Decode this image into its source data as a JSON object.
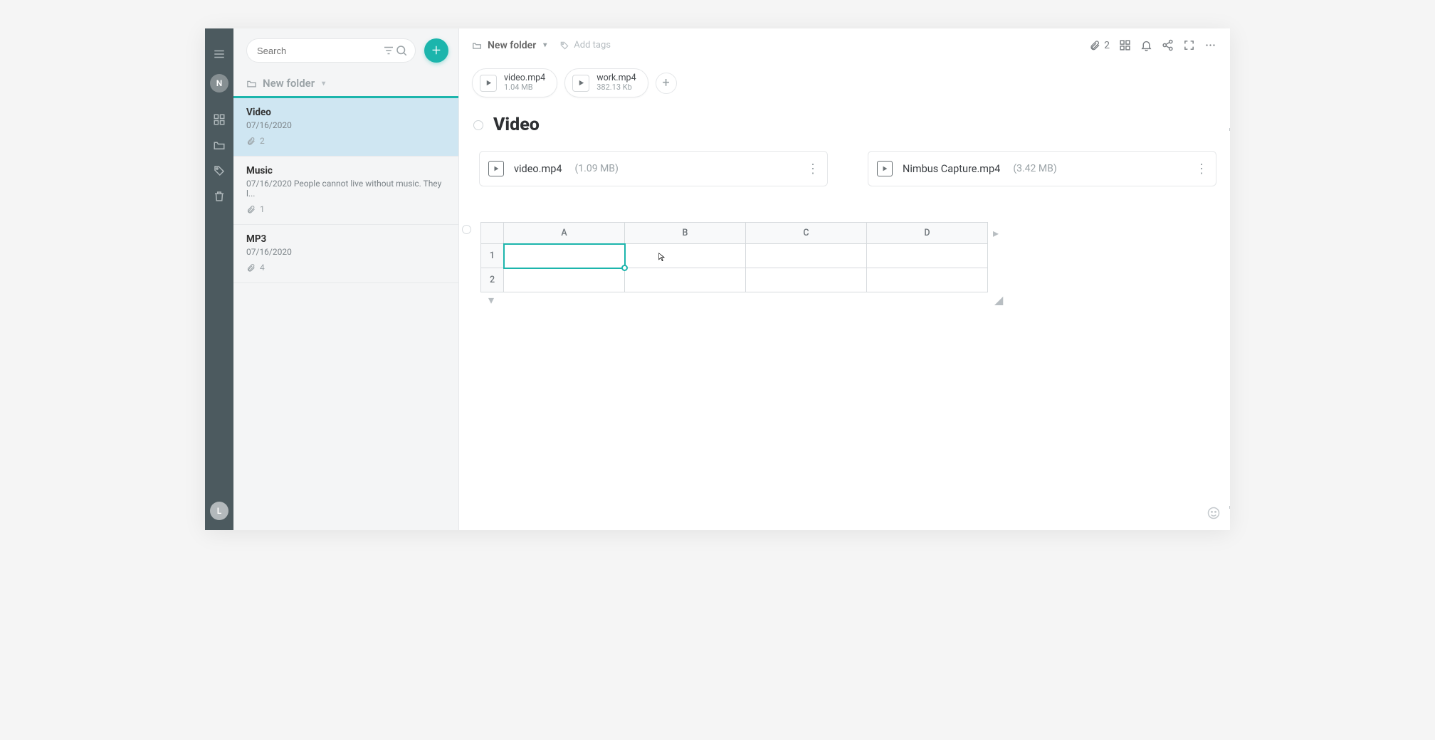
{
  "rail": {
    "avatar_top": "N",
    "avatar_bottom": "L"
  },
  "sidebar": {
    "search_placeholder": "Search",
    "folder_label": "New folder",
    "notes": [
      {
        "title": "Video",
        "date": "07/16/2020",
        "excerpt": "",
        "attachments": "2",
        "active": true
      },
      {
        "title": "Music",
        "date": "07/16/2020",
        "excerpt": "People cannot live without music. They l...",
        "attachments": "1",
        "active": false
      },
      {
        "title": "MP3",
        "date": "07/16/2020",
        "excerpt": "",
        "attachments": "4",
        "active": false
      }
    ]
  },
  "topbar": {
    "breadcrumb": "New folder",
    "add_tags": "Add tags",
    "attach_count": "2"
  },
  "chips": [
    {
      "name": "video.mp4",
      "size": "1.04 MB"
    },
    {
      "name": "work.mp4",
      "size": "382.13 Kb"
    }
  ],
  "doc_title": "Video",
  "cards": [
    {
      "name": "video.mp4",
      "size": "(1.09 MB)"
    },
    {
      "name": "Nimbus Capture.mp4",
      "size": "(3.42 MB)"
    }
  ],
  "sheet": {
    "cols": [
      "A",
      "B",
      "C",
      "D"
    ],
    "rows": [
      "1",
      "2"
    ]
  }
}
